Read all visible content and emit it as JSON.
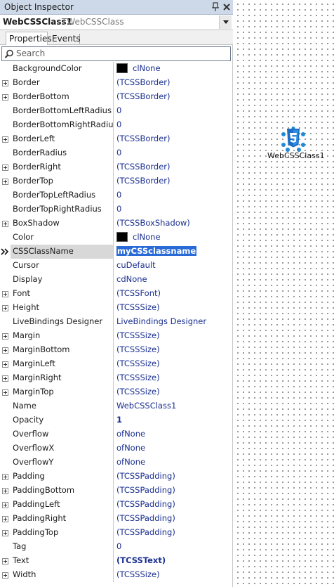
{
  "window": {
    "title": "Object Inspector"
  },
  "object_selector": {
    "name": "WebCSSClass1",
    "class_name": "TWebCSSClass"
  },
  "tabs": [
    {
      "label": "Properties",
      "active": true
    },
    {
      "label": "Events",
      "active": false
    }
  ],
  "search": {
    "placeholder": "Search"
  },
  "properties": [
    {
      "name": "BackgroundColor",
      "value": "clNone",
      "swatch": "#000000"
    },
    {
      "name": "Border",
      "value": "(TCSSBorder)",
      "expandable": true
    },
    {
      "name": "BorderBottom",
      "value": "(TCSSBorder)",
      "expandable": true
    },
    {
      "name": "BorderBottomLeftRadius",
      "value": "0"
    },
    {
      "name": "BorderBottomRightRadius",
      "value": "0"
    },
    {
      "name": "BorderLeft",
      "value": "(TCSSBorder)",
      "expandable": true
    },
    {
      "name": "BorderRadius",
      "value": "0"
    },
    {
      "name": "BorderRight",
      "value": "(TCSSBorder)",
      "expandable": true
    },
    {
      "name": "BorderTop",
      "value": "(TCSSBorder)",
      "expandable": true
    },
    {
      "name": "BorderTopLeftRadius",
      "value": "0"
    },
    {
      "name": "BorderTopRightRadius",
      "value": "0"
    },
    {
      "name": "BoxShadow",
      "value": "(TCSSBoxShadow)",
      "expandable": true
    },
    {
      "name": "Color",
      "value": "clNone",
      "swatch": "#000000"
    },
    {
      "name": "CSSClassName",
      "value": "myCSSclassname",
      "selected": true
    },
    {
      "name": "Cursor",
      "value": "cuDefault"
    },
    {
      "name": "Display",
      "value": "cdNone"
    },
    {
      "name": "Font",
      "value": "(TCSSFont)",
      "expandable": true
    },
    {
      "name": "Height",
      "value": "(TCSSSize)",
      "expandable": true
    },
    {
      "name": "LiveBindings Designer",
      "value": "LiveBindings Designer"
    },
    {
      "name": "Margin",
      "value": "(TCSSSize)",
      "expandable": true
    },
    {
      "name": "MarginBottom",
      "value": "(TCSSSize)",
      "expandable": true
    },
    {
      "name": "MarginLeft",
      "value": "(TCSSSize)",
      "expandable": true
    },
    {
      "name": "MarginRight",
      "value": "(TCSSSize)",
      "expandable": true
    },
    {
      "name": "MarginTop",
      "value": "(TCSSSize)",
      "expandable": true
    },
    {
      "name": "Name",
      "value": "WebCSSClass1"
    },
    {
      "name": "Opacity",
      "value": "1",
      "bold": true
    },
    {
      "name": "Overflow",
      "value": "ofNone"
    },
    {
      "name": "OverflowX",
      "value": "ofNone"
    },
    {
      "name": "OverflowY",
      "value": "ofNone"
    },
    {
      "name": "Padding",
      "value": "(TCSSPadding)",
      "expandable": true
    },
    {
      "name": "PaddingBottom",
      "value": "(TCSSPadding)",
      "expandable": true
    },
    {
      "name": "PaddingLeft",
      "value": "(TCSSPadding)",
      "expandable": true
    },
    {
      "name": "PaddingRight",
      "value": "(TCSSPadding)",
      "expandable": true
    },
    {
      "name": "PaddingTop",
      "value": "(TCSSPadding)",
      "expandable": true
    },
    {
      "name": "Tag",
      "value": "0"
    },
    {
      "name": "Text",
      "value": "(TCSSText)",
      "expandable": true,
      "bold": true
    },
    {
      "name": "Width",
      "value": "(TCSSSize)",
      "expandable": true
    }
  ],
  "designer": {
    "component_label": "WebCSSClass1",
    "component_icon": "css3-component-icon"
  },
  "colors": {
    "value_text": "#1a2f8f",
    "selection": "#2a6ad6",
    "titlebar": "#cdd9e8"
  }
}
